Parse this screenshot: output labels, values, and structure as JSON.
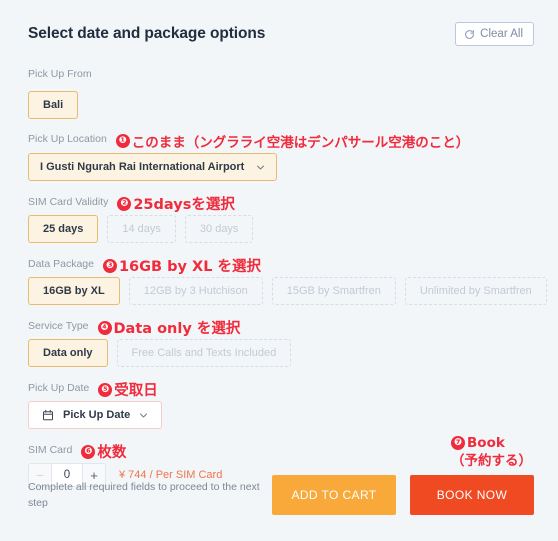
{
  "header": {
    "title": "Select date and package options",
    "clear_all_label": "Clear All",
    "clear_all_icon": "refresh-icon"
  },
  "fields": {
    "pick_up_from": {
      "label": "Pick Up From",
      "options": [
        {
          "label": "Bali",
          "selected": true
        }
      ]
    },
    "pick_up_location": {
      "label": "Pick Up Location",
      "annotation": {
        "number": "❶",
        "text": "このまま（ングラライ空港はデンパサール空港のこと）"
      },
      "value": "I Gusti Ngurah Rai International Airport",
      "chevron_icon": "chevron-down-icon"
    },
    "sim_card_validity": {
      "label": "SIM Card Validity",
      "annotation": {
        "number": "❷",
        "text": "25daysを選択"
      },
      "options": [
        {
          "label": "25 days",
          "selected": true
        },
        {
          "label": "14 days",
          "selected": false
        },
        {
          "label": "30 days",
          "selected": false
        }
      ]
    },
    "data_package": {
      "label": "Data Package",
      "annotation": {
        "number": "❸",
        "text": "16GB by XL を選択"
      },
      "options": [
        {
          "label": "16GB by XL",
          "selected": true
        },
        {
          "label": "12GB by 3 Hutchison",
          "selected": false
        },
        {
          "label": "15GB by Smartfren",
          "selected": false
        },
        {
          "label": "Unlimited by Smartfren",
          "selected": false
        }
      ]
    },
    "service_type": {
      "label": "Service Type",
      "annotation": {
        "number": "❹",
        "text": "Data only を選択"
      },
      "options": [
        {
          "label": "Data only",
          "selected": true
        },
        {
          "label": "Free Calls and Texts Included",
          "selected": false
        }
      ]
    },
    "pick_up_date": {
      "label": "Pick Up Date",
      "annotation": {
        "number": "❺",
        "text": "受取日"
      },
      "value": "Pick Up Date",
      "calendar_icon": "calendar-icon",
      "chevron_icon": "chevron-down-icon"
    },
    "sim_card": {
      "label": "SIM Card",
      "annotation": {
        "number": "❻",
        "text": "枚数"
      },
      "decrement_label": "−",
      "quantity": "0",
      "increment_label": "+",
      "price_text": "¥ 744 / Per SIM Card"
    }
  },
  "footer": {
    "note": "Complete all required fields to proceed to the next step",
    "add_to_cart_label": "ADD TO CART",
    "book_now_label": "BOOK NOW",
    "book_annotation": {
      "number": "❼",
      "line1": "Book",
      "line2": "（予約する）"
    }
  },
  "colors": {
    "background": "#f3f6f9",
    "annotation_red": "#ef2b3c",
    "selected_chip_bg": "#fdf3e2",
    "selected_chip_border": "#e6bb72",
    "price_orange": "#f0744a",
    "add_to_cart": "#f9a93a",
    "book_now": "#f04a23",
    "clear_all_text": "#7f8ba6"
  }
}
